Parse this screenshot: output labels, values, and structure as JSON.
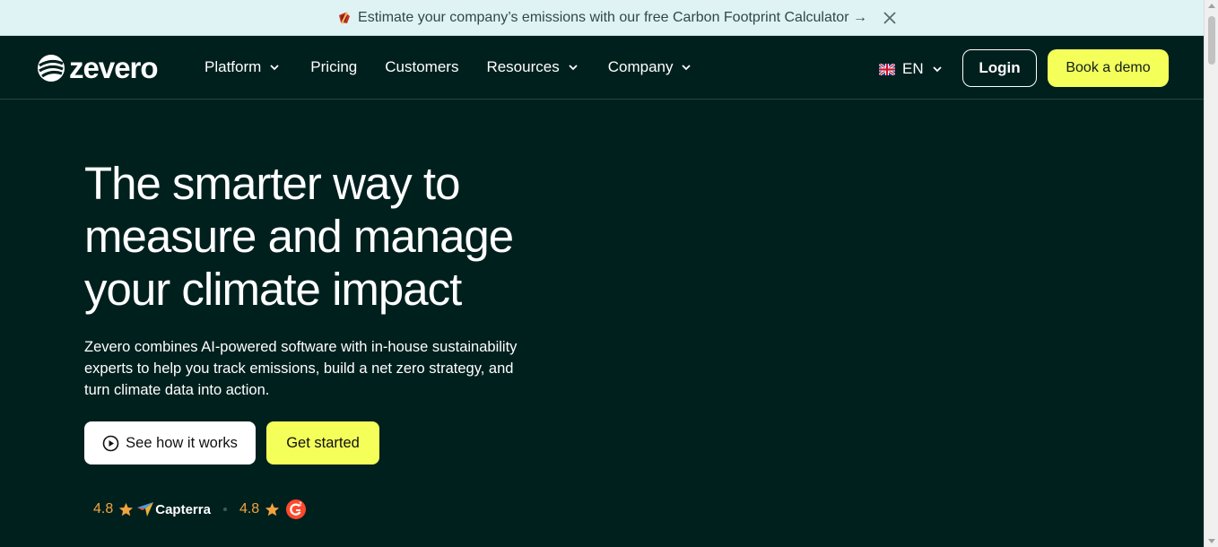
{
  "banner": {
    "text": "Estimate your company’s emissions with our free Carbon Footprint Calculator →",
    "gift_icon": "gift-icon",
    "close_icon": "close-icon"
  },
  "nav": {
    "logo_text": "zevero",
    "links": [
      {
        "label": "Platform",
        "dropdown": true
      },
      {
        "label": "Pricing",
        "dropdown": false
      },
      {
        "label": "Customers",
        "dropdown": false
      },
      {
        "label": "Resources",
        "dropdown": true
      },
      {
        "label": "Company",
        "dropdown": true
      }
    ],
    "language": "EN",
    "login_label": "Login",
    "demo_label": "Book a demo"
  },
  "hero": {
    "title_line1": "The smarter way to",
    "title_line2": "measure and manage",
    "title_line3": "your climate impact",
    "subtitle": "Zevero combines AI-powered software with in-house sustainability experts to help you track emissions, build a net zero strategy, and turn climate data into action.",
    "how_label": "See how it works",
    "start_label": "Get started"
  },
  "ratings": {
    "capterra_score": "4.8",
    "capterra_name": "Capterra",
    "g2_score": "4.8"
  },
  "colors": {
    "background": "#00201e",
    "accent": "#f4ff5a",
    "banner": "#dff3f4",
    "star": "#f2a43c",
    "g2": "#ff492c"
  }
}
